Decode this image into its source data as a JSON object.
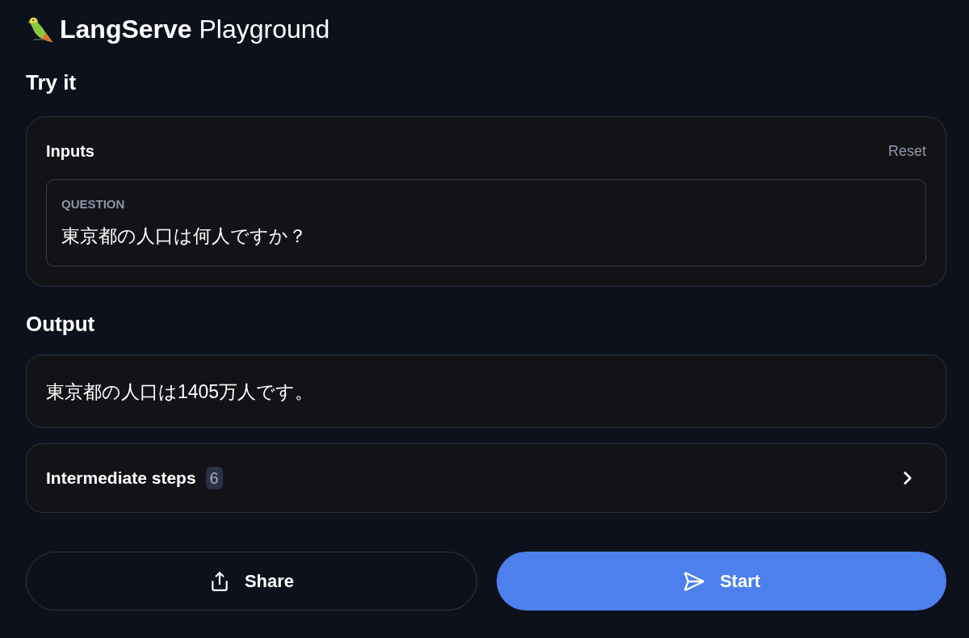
{
  "header": {
    "title": "**LangServe** Playground"
  },
  "try_it": {
    "heading": "Try it",
    "inputs": {
      "title": "Inputs",
      "reset": "Reset",
      "fields": [
        {
          "label": "QUESTION",
          "value": "東京都の人口は何人ですか？"
        }
      ]
    }
  },
  "output": {
    "heading": "Output",
    "text": "東京都の人口は1405万人です。",
    "intermediate_steps": {
      "label": "Intermediate steps",
      "count": "6",
      "expanded": false
    }
  },
  "buttons": [
    {
      "kind": "share",
      "label": "Share"
    },
    {
      "kind": "start",
      "label": "Start"
    }
  ]
}
